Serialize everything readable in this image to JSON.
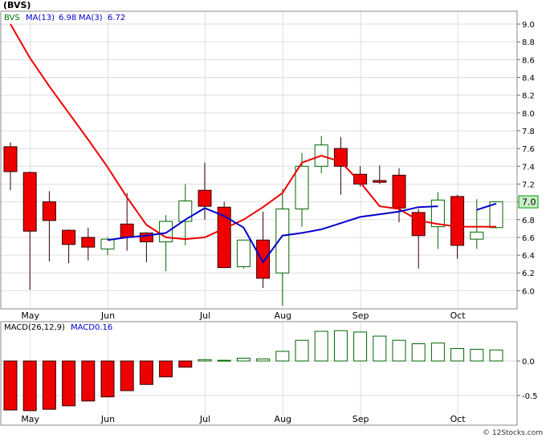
{
  "chart_data": [
    {
      "type": "candlestick",
      "title": "(BVS)",
      "ticker": "BVS",
      "legend": {
        "ma13_label": "MA(13)",
        "ma13_value": "6.98",
        "ma3_label": "MA(3)",
        "ma3_value": "6.72"
      },
      "x_labels": [
        "May",
        "Jun",
        "Jul",
        "Aug",
        "Sep",
        "Oct"
      ],
      "ylim": [
        5.7,
        9.1
      ],
      "y_ticks": [
        6.0,
        6.2,
        6.4,
        6.6,
        6.8,
        7.0,
        7.2,
        7.4,
        7.6,
        7.8,
        8.0,
        8.2,
        8.4,
        8.6,
        8.8,
        9.0
      ],
      "last_price_label": "7.0",
      "colors": {
        "up": "#ffffff",
        "down": "#ee0000",
        "ma13": "#0000cc",
        "ma3": "#ee0000",
        "price_box": "#c8f0c8"
      },
      "candles": [
        {
          "o": 7.62,
          "h": 7.67,
          "l": 7.13,
          "c": 7.34
        },
        {
          "o": 7.33,
          "h": 7.34,
          "l": 6.01,
          "c": 6.67
        },
        {
          "o": 7.0,
          "h": 7.12,
          "l": 6.33,
          "c": 6.79
        },
        {
          "o": 6.68,
          "h": 6.69,
          "l": 6.31,
          "c": 6.52
        },
        {
          "o": 6.6,
          "h": 6.71,
          "l": 6.34,
          "c": 6.49
        },
        {
          "o": 6.47,
          "h": 6.6,
          "l": 6.4,
          "c": 6.58
        },
        {
          "o": 6.75,
          "h": 7.1,
          "l": 6.45,
          "c": 6.6
        },
        {
          "o": 6.65,
          "h": 6.66,
          "l": 6.32,
          "c": 6.55
        },
        {
          "o": 6.55,
          "h": 6.85,
          "l": 6.22,
          "c": 6.78
        },
        {
          "o": 6.78,
          "h": 7.2,
          "l": 6.51,
          "c": 7.01
        },
        {
          "o": 7.13,
          "h": 7.44,
          "l": 6.8,
          "c": 6.95
        },
        {
          "o": 6.94,
          "h": 7.0,
          "l": 6.26,
          "c": 6.26
        },
        {
          "o": 6.27,
          "h": 6.57,
          "l": 6.25,
          "c": 6.57
        },
        {
          "o": 6.57,
          "h": 6.89,
          "l": 6.03,
          "c": 6.14
        },
        {
          "o": 6.2,
          "h": 7.15,
          "l": 5.83,
          "c": 6.92
        },
        {
          "o": 6.92,
          "h": 7.55,
          "l": 6.72,
          "c": 7.4
        },
        {
          "o": 7.4,
          "h": 7.74,
          "l": 7.32,
          "c": 7.64
        },
        {
          "o": 7.6,
          "h": 7.73,
          "l": 7.08,
          "c": 7.4
        },
        {
          "o": 7.31,
          "h": 7.4,
          "l": 7.17,
          "c": 7.2
        },
        {
          "o": 7.24,
          "h": 7.41,
          "l": 7.2,
          "c": 7.22
        },
        {
          "o": 7.3,
          "h": 7.38,
          "l": 6.77,
          "c": 6.93
        },
        {
          "o": 6.88,
          "h": 6.92,
          "l": 6.25,
          "c": 6.62
        },
        {
          "o": 6.72,
          "h": 7.11,
          "l": 6.47,
          "c": 7.02
        },
        {
          "o": 7.06,
          "h": 7.08,
          "l": 6.36,
          "c": 6.51
        },
        {
          "o": 6.58,
          "h": 7.03,
          "l": 6.47,
          "c": 6.66
        },
        {
          "o": 6.71,
          "h": 7.0,
          "l": 6.7,
          "c": 7.0
        }
      ],
      "ma3": [
        9.0,
        8.62,
        8.3,
        8.0,
        7.7,
        7.39,
        7.05,
        6.74,
        6.6,
        6.58,
        6.6,
        6.7,
        6.8,
        6.94,
        7.1,
        7.44,
        7.52,
        7.45,
        7.22,
        6.95,
        6.92,
        6.79,
        6.75,
        6.72,
        6.72,
        6.72
      ],
      "ma13": [
        null,
        null,
        null,
        null,
        null,
        6.57,
        6.6,
        6.62,
        6.65,
        6.8,
        6.93,
        6.84,
        6.71,
        6.32,
        6.62,
        6.65,
        6.69,
        6.76,
        6.83,
        6.86,
        6.89,
        6.94,
        6.95,
        null,
        6.91,
        6.98
      ]
    },
    {
      "type": "bar",
      "title": "MACD(26,12,9)",
      "macd_label": "MACD",
      "macd_value": "0.16",
      "x_labels": [
        "May",
        "Jun",
        "Jul",
        "Aug",
        "Sep",
        "Oct"
      ],
      "ylim": [
        -0.73,
        0.3
      ],
      "y_ticks": [
        0.0,
        -0.5
      ],
      "y_tick_labels": [
        "0.0",
        "-0.5"
      ],
      "colors": {
        "positive": "#ffffff",
        "positive_stroke": "#006600",
        "negative": "#ee0000"
      },
      "values": [
        -0.71,
        -0.72,
        -0.7,
        -0.65,
        -0.58,
        -0.52,
        -0.43,
        -0.34,
        -0.23,
        -0.09,
        0.02,
        0.01,
        0.04,
        0.03,
        0.14,
        0.3,
        0.43,
        0.44,
        0.42,
        0.36,
        0.3,
        0.25,
        0.26,
        0.18,
        0.17,
        0.16
      ]
    }
  ],
  "footer": {
    "watermark": "© 12Stocks.com"
  }
}
